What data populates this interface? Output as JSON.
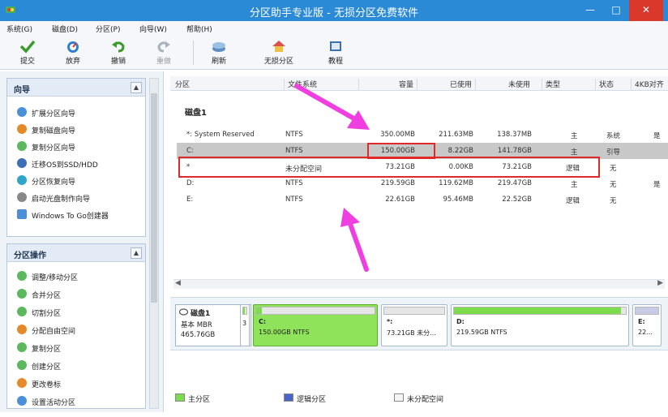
{
  "window": {
    "title": "分区助手专业版 - 无损分区免费软件",
    "min_glyph": "—",
    "max_glyph": "□",
    "close_glyph": "✕"
  },
  "menu": [
    "系统(G)",
    "磁盘(D)",
    "分区(P)",
    "向导(W)",
    "帮助(H)"
  ],
  "toolbar": {
    "submit": "提交",
    "discard": "放弃",
    "undo": "撤销",
    "redo": "重做",
    "refresh": "刷新",
    "lossless": "无损分区",
    "tutorial": "教程"
  },
  "sidebar": {
    "wizard_title": "向导",
    "wizard_items": [
      "扩展分区向导",
      "复制磁盘向导",
      "复制分区向导",
      "迁移OS到SSD/HDD",
      "分区恢复向导",
      "启动光盘制作向导",
      "Windows To Go创建器"
    ],
    "ops_title": "分区操作",
    "ops_items": [
      "调整/移动分区",
      "合并分区",
      "切割分区",
      "分配自由空间",
      "复制分区",
      "创建分区",
      "更改卷标",
      "设置活动分区"
    ]
  },
  "table": {
    "columns": [
      "分区",
      "文件系统",
      "容量",
      "已使用",
      "未使用",
      "类型",
      "状态",
      "4KB对齐"
    ],
    "disk_label": "磁盘1",
    "rows": [
      {
        "name": "*: System Reserved",
        "fs": "NTFS",
        "cap": "350.00MB",
        "used": "211.63MB",
        "free": "138.37MB",
        "type": "主",
        "status": "系统",
        "align": "是"
      },
      {
        "name": "C:",
        "fs": "NTFS",
        "cap": "150.00GB",
        "used": "8.22GB",
        "free": "141.78GB",
        "type": "主",
        "status": "引导",
        "align": ""
      },
      {
        "name": "*",
        "fs": "未分配空间",
        "cap": "73.21GB",
        "used": "0.00KB",
        "free": "73.21GB",
        "type": "逻辑",
        "status": "无",
        "align": ""
      },
      {
        "name": "D:",
        "fs": "NTFS",
        "cap": "219.59GB",
        "used": "119.62MB",
        "free": "219.47GB",
        "type": "主",
        "status": "无",
        "align": "是"
      },
      {
        "name": "E:",
        "fs": "NTFS",
        "cap": "22.61GB",
        "used": "95.46MB",
        "free": "22.52GB",
        "type": "逻辑",
        "status": "无",
        "align": ""
      }
    ]
  },
  "diskmap": {
    "disk_name": "磁盘1",
    "disk_type": "基本 MBR",
    "disk_size": "465.76GB",
    "small_label": "3",
    "blocks": [
      {
        "name": "C:",
        "desc": "150.00GB NTFS",
        "fill": 0.05
      },
      {
        "name": "*:",
        "desc": "73.21GB 未分...",
        "fill": 0
      },
      {
        "name": "D:",
        "desc": "219.59GB NTFS",
        "fill": 0.01
      },
      {
        "name": "E:",
        "desc": "22...",
        "fill": 0.0
      }
    ]
  },
  "legend": {
    "primary": "主分区",
    "logical": "逻辑分区",
    "unalloc": "未分配空间"
  },
  "colors": {
    "titlebar": "#2a8ad6",
    "highlight_box": "#e02a2a",
    "arrow": "#f03fe0",
    "primary": "#7ddc4c",
    "logical": "#4a63c8"
  }
}
